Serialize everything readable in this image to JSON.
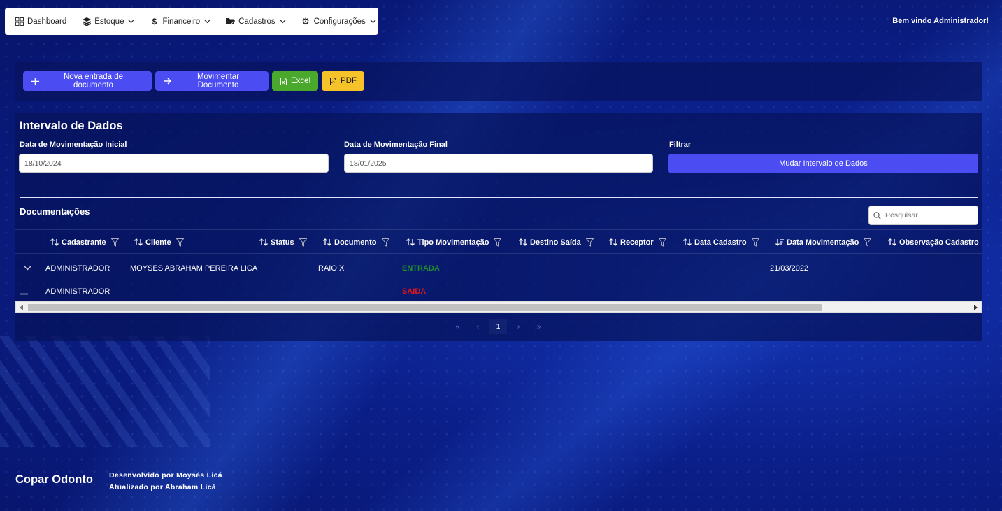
{
  "nav": {
    "items": [
      {
        "label": "Dashboard",
        "icon": "grid-icon",
        "has_dropdown": false
      },
      {
        "label": "Estoque",
        "icon": "layers-icon",
        "has_dropdown": true
      },
      {
        "label": "Financeiro",
        "icon": "dollar-icon",
        "has_dropdown": true
      },
      {
        "label": "Cadastros",
        "icon": "folder-edit-icon",
        "has_dropdown": true
      },
      {
        "label": "Configurações",
        "icon": "gear-icon",
        "has_dropdown": true
      }
    ],
    "welcome": "Bem vindo Administrador!"
  },
  "toolbar": {
    "new_entry": "Nova entrada de documento",
    "move_doc": "Movimentar Documento",
    "excel": "Excel",
    "pdf": "PDF"
  },
  "interval": {
    "title": "Intervalo de Dados",
    "start_label": "Data de Movimentação Inicial",
    "start_value": "18/10/2024",
    "end_label": "Data de Movimentação Final",
    "end_value": "18/01/2025",
    "filter_label": "Filtrar",
    "filter_button": "Mudar Intervalo de Dados"
  },
  "docs": {
    "title": "Documentações",
    "search_placeholder": "Pesquisar",
    "columns": [
      "Cadastrante",
      "Cliente",
      "Status",
      "Documento",
      "Tipo Movimentação",
      "Destino Saída",
      "Receptor",
      "Data Cadastro",
      "Data Movimentação",
      "Observação Cadastro"
    ],
    "rows": [
      {
        "cadastrante": "ADMINISTRADOR",
        "cliente": "MOYSES ABRAHAM PEREIRA LICA",
        "status": "",
        "documento": "RAIO X",
        "tipo": "ENTRADA",
        "destino": "",
        "receptor": "",
        "data_cadastro": "",
        "data_movimentacao": "21/03/2022",
        "observacao": ""
      },
      {
        "cadastrante": "ADMINISTRADOR",
        "cliente": "",
        "status": "",
        "documento": "",
        "tipo": "SAIDA",
        "destino": "",
        "receptor": "",
        "data_cadastro": "",
        "data_movimentacao": "",
        "observacao": ""
      }
    ],
    "pagination": {
      "current": "1"
    }
  },
  "footer": {
    "brand": "Copar Odonto",
    "dev": "Desenvolvido por Moysés Licá",
    "updated": "Atualizado por Abraham Licá"
  },
  "colors": {
    "primary": "#4b4df2",
    "excel": "#4aa82d",
    "pdf": "#f6c22a",
    "entrada": "#1f8f2b",
    "saida": "#e0161e"
  }
}
